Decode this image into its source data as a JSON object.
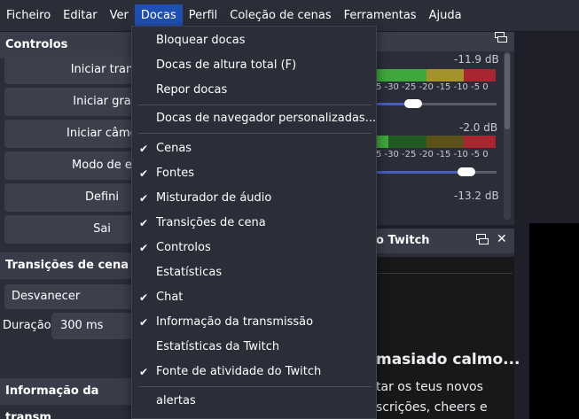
{
  "menubar": {
    "items": [
      "Ficheiro",
      "Editar",
      "Ver",
      "Docas",
      "Perfil",
      "Coleção de cenas",
      "Ferramentas",
      "Ajuda"
    ],
    "active": "Docas"
  },
  "controls": {
    "title": "Controlos",
    "buttons": [
      "Iniciar tran",
      "Iniciar gra",
      "Iniciar câmera v",
      "Modo de e",
      "Defini",
      "Sai"
    ]
  },
  "transitions": {
    "title": "Transições de cena",
    "selected": "Desvanecer",
    "duration_label": "Duração",
    "duration_value": "300 ms"
  },
  "info_title": "Informação da transm",
  "mixer": {
    "channels": [
      {
        "db": "-11.9 dB",
        "ticks": "5  -30  -25  -20  -15  -10  -5   0",
        "volume": 0.68
      },
      {
        "db": "-2.0 dB",
        "ticks": "5  -30  -25  -20  -15  -10  -5   0",
        "volume": 0.92
      },
      {
        "db": "-13.2 dB"
      }
    ]
  },
  "twitch": {
    "title": "o Twitch",
    "heading": "masiado calmo...",
    "line1": "tar os teus novos",
    "line2": "scrições, cheers e"
  },
  "docas_menu": {
    "items": [
      {
        "label": "Bloquear docas",
        "checked": false
      },
      {
        "label": "Docas de altura total (F)",
        "checked": false
      },
      {
        "label": "Repor docas",
        "checked": false
      },
      {
        "label": "Docas de navegador personalizadas...",
        "checked": false
      },
      {
        "label": "Cenas",
        "checked": true
      },
      {
        "label": "Fontes",
        "checked": true
      },
      {
        "label": "Misturador de áudio",
        "checked": true
      },
      {
        "label": "Transições de cena",
        "checked": true
      },
      {
        "label": "Controlos",
        "checked": true
      },
      {
        "label": "Estatísticas",
        "checked": false
      },
      {
        "label": "Chat",
        "checked": true
      },
      {
        "label": "Informação da transmissão",
        "checked": true
      },
      {
        "label": "Estatísticas da Twitch",
        "checked": false
      },
      {
        "label": "Fonte de atividade do Twitch",
        "checked": true
      },
      {
        "label": "alertas",
        "checked": false
      }
    ]
  },
  "colors": {
    "menu_active": "#1f4fb1",
    "meter_green": "#3ea83a",
    "meter_yellow": "#a3932a",
    "meter_red": "#a8262f"
  }
}
